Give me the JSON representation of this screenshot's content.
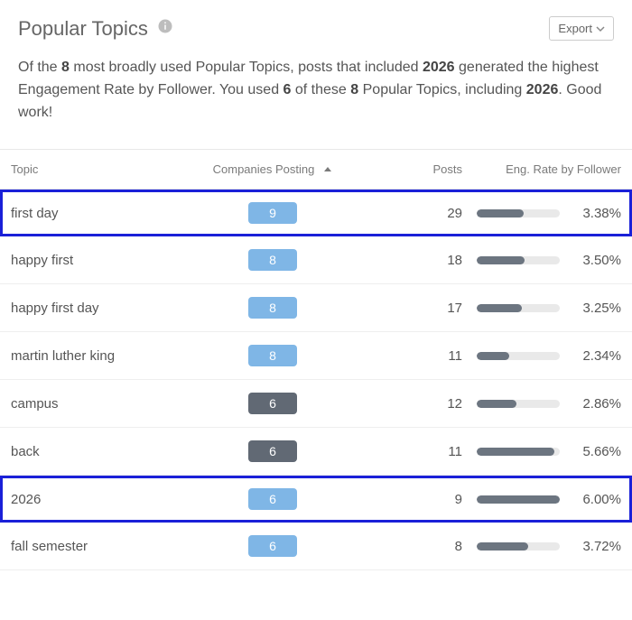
{
  "header": {
    "title": "Popular Topics",
    "export_label": "Export"
  },
  "summary": {
    "html": "Of the <b>8</b> most broadly used Popular Topics, posts that included <b>2026</b> generated the highest Engagement Rate by Follower. You used <b>6</b> of these <b>8</b> Popular Topics, including <b>2026</b>. Good work!"
  },
  "table": {
    "columns": {
      "topic": "Topic",
      "companies": "Companies Posting",
      "posts": "Posts",
      "engagement": "Eng. Rate by Follower"
    },
    "sort_column": "companies",
    "sort_dir": "desc",
    "rows": [
      {
        "topic": "first day",
        "companies": 9,
        "used": true,
        "posts": 29,
        "eng_rate": "3.38%",
        "bar_pct": 56,
        "highlight": true
      },
      {
        "topic": "happy first",
        "companies": 8,
        "used": true,
        "posts": 18,
        "eng_rate": "3.50%",
        "bar_pct": 58,
        "highlight": false
      },
      {
        "topic": "happy first day",
        "companies": 8,
        "used": true,
        "posts": 17,
        "eng_rate": "3.25%",
        "bar_pct": 54,
        "highlight": false
      },
      {
        "topic": "martin luther king",
        "companies": 8,
        "used": true,
        "posts": 11,
        "eng_rate": "2.34%",
        "bar_pct": 39,
        "highlight": false
      },
      {
        "topic": "campus",
        "companies": 6,
        "used": false,
        "posts": 12,
        "eng_rate": "2.86%",
        "bar_pct": 48,
        "highlight": false
      },
      {
        "topic": "back",
        "companies": 6,
        "used": false,
        "posts": 11,
        "eng_rate": "5.66%",
        "bar_pct": 94,
        "highlight": false
      },
      {
        "topic": "2026",
        "companies": 6,
        "used": true,
        "posts": 9,
        "eng_rate": "6.00%",
        "bar_pct": 100,
        "highlight": true
      },
      {
        "topic": "fall semester",
        "companies": 6,
        "used": true,
        "posts": 8,
        "eng_rate": "3.72%",
        "bar_pct": 62,
        "highlight": false
      }
    ]
  },
  "chart_data": {
    "type": "table",
    "title": "Popular Topics",
    "columns": [
      "Topic",
      "Companies Posting",
      "Posts",
      "Eng. Rate by Follower"
    ],
    "rows": [
      [
        "first day",
        9,
        29,
        3.38
      ],
      [
        "happy first",
        8,
        18,
        3.5
      ],
      [
        "happy first day",
        8,
        17,
        3.25
      ],
      [
        "martin luther king",
        8,
        11,
        2.34
      ],
      [
        "campus",
        6,
        12,
        2.86
      ],
      [
        "back",
        6,
        11,
        5.66
      ],
      [
        "2026",
        6,
        9,
        6.0
      ],
      [
        "fall semester",
        6,
        8,
        3.72
      ]
    ]
  }
}
